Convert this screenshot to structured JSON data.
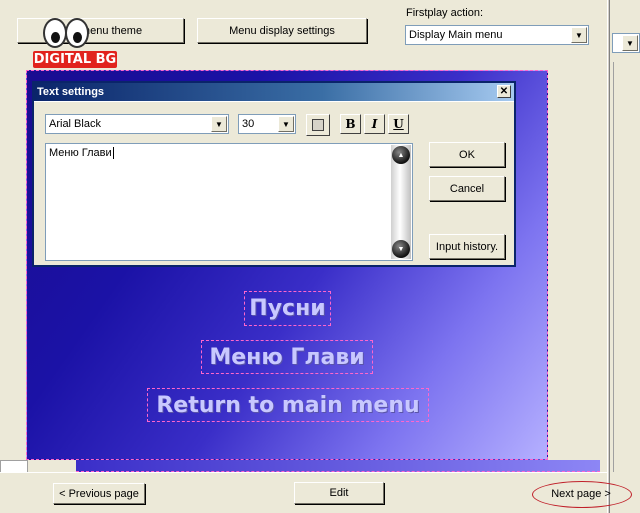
{
  "toolbar": {
    "edit_theme_label": "Edit menu theme",
    "display_settings_label": "Menu display settings",
    "firstplay_label": "Firstplay action:",
    "firstplay_value": "Display Main menu"
  },
  "logo": {
    "text": "DIGITAL BG"
  },
  "dialog": {
    "title": "Text settings",
    "font_value": "Arial Black",
    "size_value": "30",
    "bold_label": "B",
    "italic_label": "I",
    "underline_label": "U",
    "text_value": "Меню Глави",
    "ok_label": "OK",
    "cancel_label": "Cancel",
    "history_label": "Input history."
  },
  "menu": {
    "items": [
      "Пусни",
      "Меню Глави",
      "Return to main menu"
    ]
  },
  "bottom": {
    "prev_label": "< Previous page",
    "edit_label": "Edit",
    "next_label": "Next page >"
  },
  "colors": {
    "title_bar": "#0a246a",
    "canvas_dark": "#1a0c90",
    "canvas_light": "#b5b0ff",
    "selection": "#ff66cc",
    "logo_red": "#e1231d"
  }
}
